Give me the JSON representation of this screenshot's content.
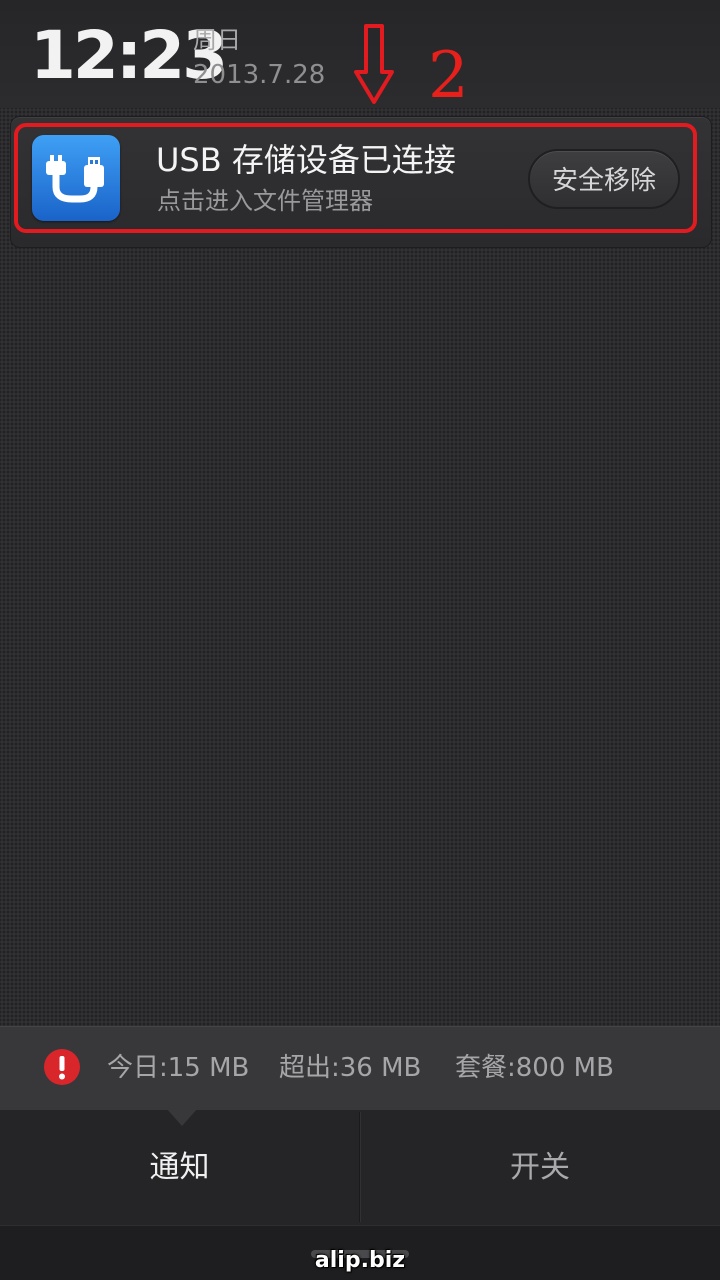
{
  "status": {
    "time": "12:23",
    "weekday": "周日",
    "date": "2013.7.28"
  },
  "annotation": {
    "arrow_icon": "down-arrow-icon",
    "number": "2",
    "color": "#e11b1f"
  },
  "notification": {
    "app_icon": "usb-icon",
    "title": "USB 存储设备已连接",
    "subtitle": "点击进入文件管理器",
    "action_label": "安全移除"
  },
  "data_usage": {
    "alert_icon": "alert-icon",
    "today": "今日:15 MB",
    "over": "超出:36 MB",
    "plan": "套餐:800 MB"
  },
  "tabs": [
    {
      "label": "通知",
      "active": true
    },
    {
      "label": "开关",
      "active": false
    }
  ],
  "watermark": "alip.biz"
}
